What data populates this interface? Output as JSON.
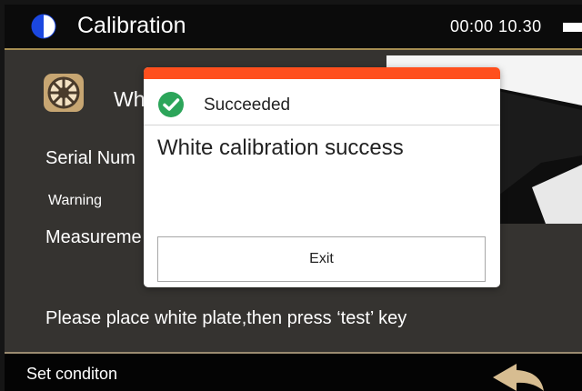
{
  "header": {
    "title": "Calibration",
    "time": "00:00 10.30",
    "icon": "contrast-icon",
    "battery_icon": "battery-icon"
  },
  "panel": {
    "heading_visible": "Wh",
    "serial_label_visible": "Serial Num",
    "warning_label": "Warning",
    "measurement_label_visible": "Measureme",
    "instruction": "Please place white plate,then press ‘test’ key"
  },
  "dialog": {
    "status": "Succeeded",
    "message": "White calibration success",
    "exit_label": "Exit",
    "colors": {
      "header_bar": "#ff4f1d",
      "success": "#2ca55a"
    }
  },
  "footer": {
    "label": "Set conditon",
    "back_icon": "back-arrow-icon"
  }
}
